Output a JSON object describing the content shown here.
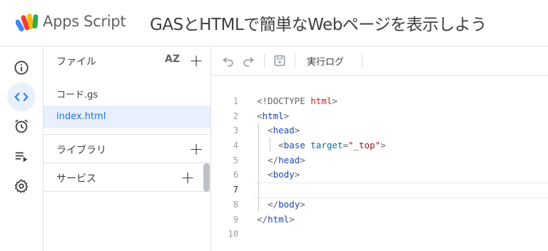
{
  "header": {
    "app_name": "Apps Script",
    "project_title": "GASとHTMLで簡単なWebページを表示しよう",
    "logo_colors": [
      "#4285f4",
      "#ea4335",
      "#fbbc04",
      "#34a853"
    ]
  },
  "rail": {
    "items": [
      {
        "name": "overview",
        "icon": "info-icon"
      },
      {
        "name": "editor",
        "icon": "code-icon",
        "active": true
      },
      {
        "name": "triggers",
        "icon": "alarm-icon"
      },
      {
        "name": "executions",
        "icon": "playlist-icon"
      },
      {
        "name": "settings",
        "icon": "gear-icon"
      }
    ]
  },
  "files_panel": {
    "title": "ファイル",
    "sort_label": "AZ",
    "files": [
      {
        "label": "コード.gs",
        "selected": false
      },
      {
        "label": "index.html",
        "selected": true
      }
    ],
    "sections": [
      {
        "label": "ライブラリ"
      },
      {
        "label": "サービス"
      }
    ]
  },
  "toolbar": {
    "undo_icon": "undo-icon",
    "redo_icon": "redo-icon",
    "save_icon": "save-icon",
    "execution_log_label": "実行ログ"
  },
  "editor": {
    "current_line": 7,
    "line_numbers": [
      "1",
      "2",
      "3",
      "4",
      "5",
      "6",
      "7",
      "8",
      "9",
      "10"
    ],
    "lines": [
      "<!DOCTYPE html>",
      "<html>",
      "  <head>",
      "    <base target=\"_top\">",
      "  </head>",
      "  <body>",
      "",
      "  </body>",
      "</html>",
      ""
    ],
    "colors": {
      "tag": "#1a48a8",
      "attr": "#0b6e87",
      "string": "#a31515",
      "doctype_keyword": "#c5221f"
    }
  }
}
